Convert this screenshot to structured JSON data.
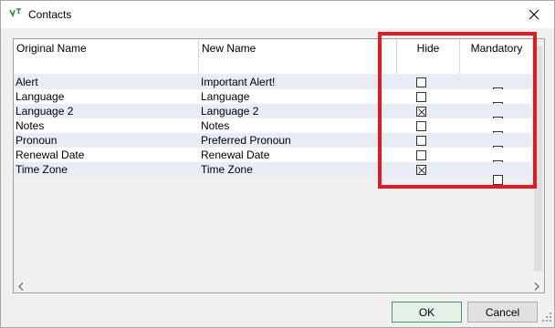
{
  "window": {
    "title": "Contacts"
  },
  "columns": {
    "original_name": "Original Name",
    "new_name": "New Name",
    "hide": "Hide",
    "mandatory": "Mandatory"
  },
  "rows": [
    {
      "original": "Alert",
      "new": "Important Alert!",
      "hide": false,
      "mandatory": false
    },
    {
      "original": "Language",
      "new": "Language",
      "hide": false,
      "mandatory": false
    },
    {
      "original": "Language 2",
      "new": "Language 2",
      "hide": true,
      "mandatory": false
    },
    {
      "original": "Notes",
      "new": "Notes",
      "hide": false,
      "mandatory": false
    },
    {
      "original": "Pronoun",
      "new": "Preferred Pronoun",
      "hide": false,
      "mandatory": true
    },
    {
      "original": "Renewal Date",
      "new": "Renewal Date",
      "hide": false,
      "mandatory": false
    },
    {
      "original": "Time Zone",
      "new": "Time Zone",
      "hide": true,
      "mandatory": false
    }
  ],
  "buttons": {
    "ok": "OK",
    "cancel": "Cancel"
  },
  "colors": {
    "row_alt": "#e6edf7",
    "highlight": "#e01b24",
    "ok_border": "#3c9b59"
  }
}
